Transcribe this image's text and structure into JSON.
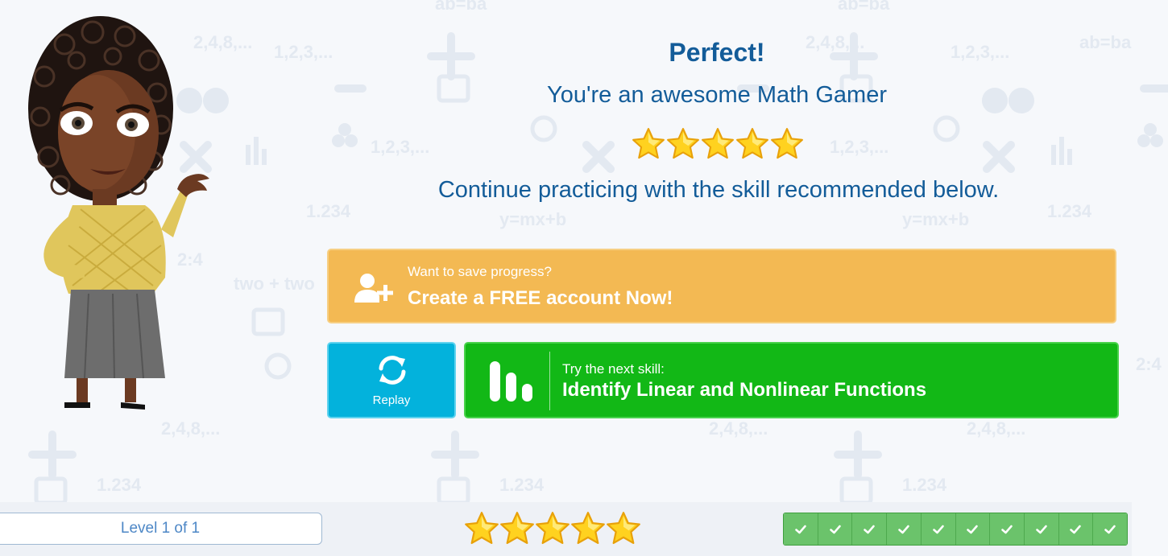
{
  "result": {
    "title": "Perfect!",
    "subtitle": "You're an awesome Math Gamer",
    "stars_earned": 5,
    "stars_total": 5,
    "recommendation": "Continue practicing with the skill recommended below."
  },
  "create_account": {
    "prompt": "Want to save progress?",
    "cta": "Create a FREE account Now!",
    "icon": "add-user-icon"
  },
  "replay": {
    "label": "Replay",
    "icon": "replay-icon"
  },
  "next_skill": {
    "prefix": "Try the next skill:",
    "name": "Identify Linear and Nonlinear Functions",
    "icon": "skill-chart-icon"
  },
  "footer": {
    "level_text": "Level 1 of 1",
    "stars": 5,
    "completed_questions": 10,
    "total_questions": 10
  },
  "colors": {
    "title_blue": "#135c99",
    "account_orange": "#f3b953",
    "replay_blue": "#03b2dc",
    "next_green": "#12b816",
    "check_green": "#6bc36b",
    "star_yellow": "#ffd21f"
  }
}
